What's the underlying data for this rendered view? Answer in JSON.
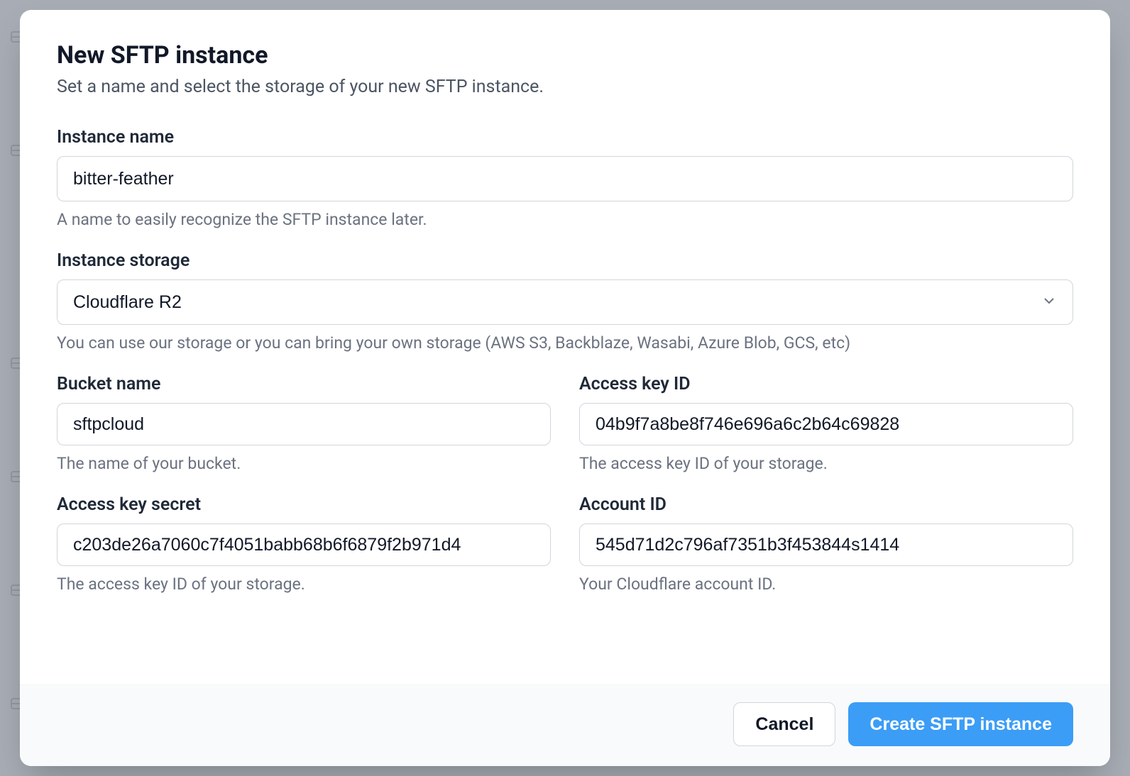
{
  "modal": {
    "title": "New SFTP instance",
    "subtitle": "Set a name and select the storage of your new SFTP instance."
  },
  "fields": {
    "instance_name": {
      "label": "Instance name",
      "value": "bitter-feather",
      "help": "A name to easily recognize the SFTP instance later."
    },
    "instance_storage": {
      "label": "Instance storage",
      "value": "Cloudflare R2",
      "help": "You can use our storage or you can bring your own storage (AWS S3, Backblaze, Wasabi, Azure Blob, GCS, etc)"
    },
    "bucket_name": {
      "label": "Bucket name",
      "value": "sftpcloud",
      "help": "The name of your bucket."
    },
    "access_key_id": {
      "label": "Access key ID",
      "value": "04b9f7a8be8f746e696a6c2b64c69828",
      "help": "The access key ID of your storage."
    },
    "access_key_secret": {
      "label": "Access key secret",
      "value": "c203de26a7060c7f4051babb68b6f6879f2b971d4",
      "help": "The access key ID of your storage."
    },
    "account_id": {
      "label": "Account ID",
      "value": "545d71d2c796af7351b3f453844s1414",
      "help": "Your Cloudflare account ID."
    }
  },
  "buttons": {
    "cancel": "Cancel",
    "create": "Create SFTP instance"
  }
}
